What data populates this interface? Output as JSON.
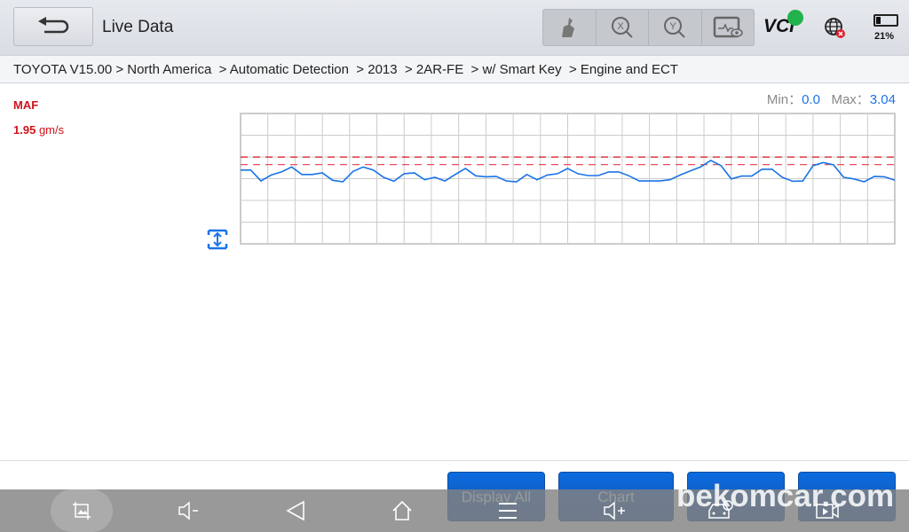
{
  "header": {
    "title": "Live Data",
    "vci_label": "VCI",
    "battery_percent": "21%",
    "battery_level": 0.21
  },
  "toolbar": {
    "icons": [
      "clean-brush-icon",
      "zoom-x-icon",
      "zoom-y-icon",
      "monitor-eye-icon"
    ]
  },
  "breadcrumb": "TOYOTA V15.00 > North America  > Automatic Detection  > 2013  > 2AR-FE  > w/ Smart Key  > Engine and ECT",
  "parameter": {
    "name": "MAF",
    "value": "1.95",
    "unit": "gm/s"
  },
  "range": {
    "min_label": "Min：",
    "min": "0.0",
    "max_label": "Max：",
    "max": "3.04"
  },
  "chart_data": {
    "type": "line",
    "title": "",
    "xlabel": "",
    "ylabel": "",
    "ylim": [
      0,
      5
    ],
    "grid": true,
    "ref_lines": [
      3.33,
      3.04
    ],
    "series": [
      {
        "color": "#1a73e8",
        "values": [
          2.83,
          2.83,
          2.41,
          2.64,
          2.76,
          2.95,
          2.66,
          2.66,
          2.72,
          2.44,
          2.38,
          2.78,
          2.95,
          2.83,
          2.55,
          2.4,
          2.69,
          2.72,
          2.46,
          2.55,
          2.41,
          2.66,
          2.89,
          2.61,
          2.57,
          2.59,
          2.41,
          2.38,
          2.66,
          2.46,
          2.64,
          2.69,
          2.89,
          2.69,
          2.62,
          2.62,
          2.76,
          2.76,
          2.61,
          2.41,
          2.41,
          2.41,
          2.46,
          2.64,
          2.8,
          2.95,
          3.2,
          3.0,
          2.49,
          2.6,
          2.6,
          2.86,
          2.86,
          2.55,
          2.4,
          2.41,
          3.0,
          3.12,
          3.03,
          2.55,
          2.49,
          2.38,
          2.59,
          2.57,
          2.44
        ]
      }
    ],
    "colors": {
      "line": "#1a73e8",
      "ref": "#d0131b",
      "grid": "#cccccc"
    }
  },
  "buttons": [
    {
      "label": "Display All"
    },
    {
      "label": "Chart"
    },
    {
      "label": ""
    },
    {
      "label": ""
    }
  ],
  "watermark": "bekomcar.com",
  "nav": [
    "screenshot-icon",
    "volume-down-icon",
    "back-icon",
    "home-icon",
    "menu-icon",
    "volume-up-icon",
    "car-icon",
    "screen-record-icon"
  ]
}
